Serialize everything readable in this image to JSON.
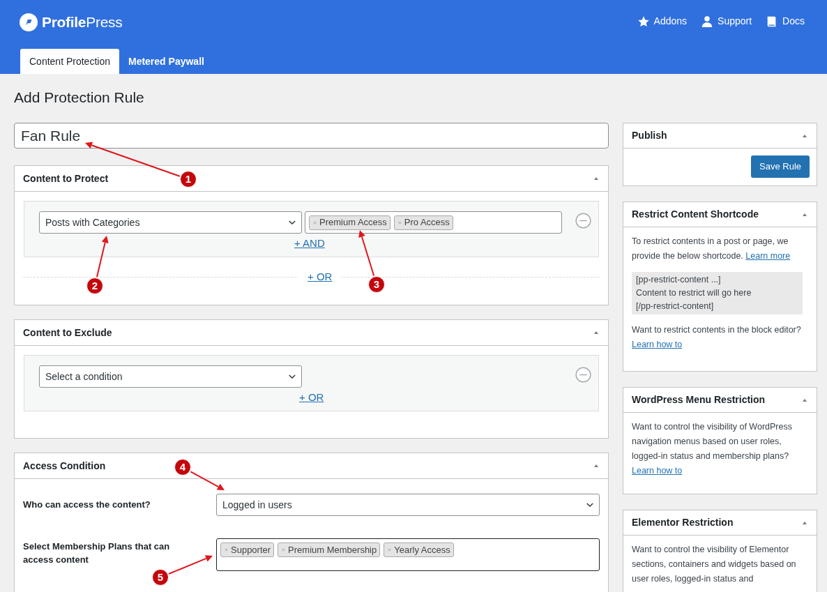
{
  "header": {
    "logo_bold": "Profile",
    "logo_light": "Press",
    "links": [
      {
        "label": "Addons"
      },
      {
        "label": "Support"
      },
      {
        "label": "Docs"
      }
    ]
  },
  "tabs": [
    {
      "label": "Content Protection",
      "selected": true
    },
    {
      "label": "Metered Paywall",
      "selected": false
    }
  ],
  "page_title": "Add Protection Rule",
  "rule_name": {
    "value": "Fan Rule"
  },
  "content_to_protect": {
    "title": "Content to Protect",
    "condition": "Posts with Categories",
    "tags": [
      "Premium Access",
      "Pro Access"
    ],
    "and_link": "+ AND",
    "or_link": "+ OR"
  },
  "content_to_exclude": {
    "title": "Content to Exclude",
    "condition": "Select a condition",
    "or_link": "+ OR"
  },
  "access_condition": {
    "title": "Access Condition",
    "who_label": "Who can access the content?",
    "who_value": "Logged in users",
    "plans_label": "Select Membership Plans that can access content",
    "plans": [
      "Supporter",
      "Premium Membership",
      "Yearly Access"
    ]
  },
  "sidebar": [
    {
      "kind": "publish",
      "title": "Publish",
      "button": "Save Rule"
    },
    {
      "kind": "info",
      "title": "Restrict Content Shortcode",
      "blocks": [
        {
          "kind": "paragraph",
          "text": "To restrict contents in a post or page, we provide the below shortcode.",
          "link": "Learn more"
        },
        {
          "kind": "code",
          "lines": [
            "[pp-restrict-content ...]",
            "Content to restrict will go here",
            "[/pp-restrict-content]"
          ]
        },
        {
          "kind": "paragraph",
          "text": "Want to restrict contents in the block editor?",
          "link": "Learn how to"
        }
      ]
    },
    {
      "kind": "info",
      "title": "WordPress Menu Restriction",
      "blocks": [
        {
          "kind": "paragraph",
          "text": "Want to control the visibility of WordPress navigation menus based on user roles, logged-in status and membership plans?",
          "link": "Learn how to"
        }
      ]
    },
    {
      "kind": "info",
      "title": "Elementor Restriction",
      "blocks": [
        {
          "kind": "paragraph",
          "text": "Want to control the visibility of Elementor sections, containers and widgets based on user roles, logged-in status and"
        }
      ]
    }
  ],
  "callouts": [
    "1",
    "2",
    "3",
    "4",
    "5"
  ]
}
